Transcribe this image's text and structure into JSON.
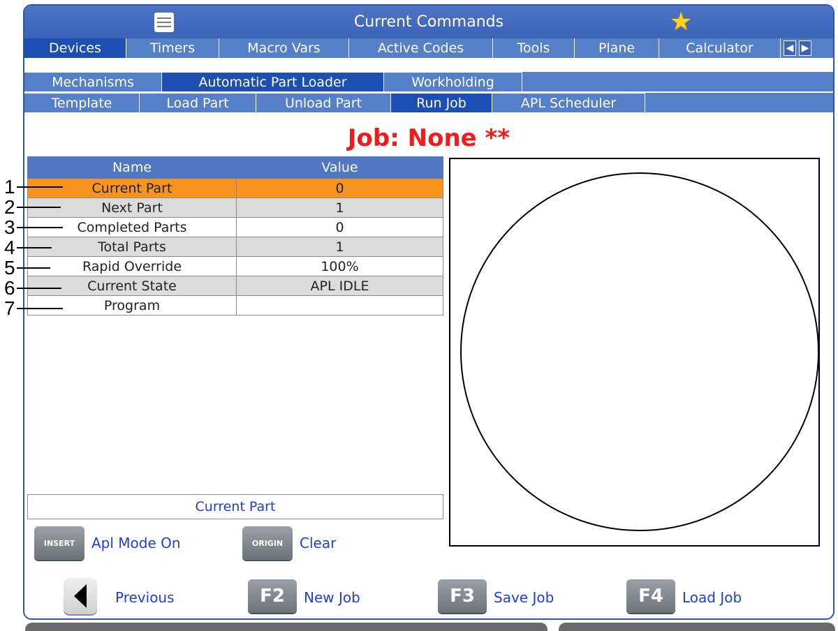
{
  "titlebar": {
    "title": "Current Commands",
    "menu_icon": "hamburger-icon",
    "favorite_icon": "star-icon"
  },
  "tabs_row1": [
    "Devices",
    "Timers",
    "Macro Vars",
    "Active Codes",
    "Tools",
    "Plane",
    "Calculator"
  ],
  "tabs_row1_active": "Devices",
  "tabs_row2": [
    "Mechanisms",
    "Automatic Part Loader",
    "Workholding"
  ],
  "tabs_row2_active": "Automatic Part Loader",
  "tabs_row3": [
    "Template",
    "Load Part",
    "Unload Part",
    "Run Job",
    "APL Scheduler"
  ],
  "tabs_row3_active": "Run Job",
  "job": {
    "title": "Job: None **"
  },
  "table": {
    "headers": {
      "name": "Name",
      "value": "Value"
    },
    "rows": [
      {
        "name": "Current Part",
        "value": "0"
      },
      {
        "name": "Next Part",
        "value": "1"
      },
      {
        "name": "Completed Parts",
        "value": "0"
      },
      {
        "name": "Total Parts",
        "value": "1"
      },
      {
        "name": "Rapid Override",
        "value": "100%"
      },
      {
        "name": "Current State",
        "value": "APL IDLE"
      },
      {
        "name": "Program",
        "value": ""
      }
    ],
    "selected_row": 0
  },
  "callouts": [
    "1",
    "2",
    "3",
    "4",
    "5",
    "6",
    "7"
  ],
  "info": {
    "text": "Current Part"
  },
  "keys": {
    "insert": {
      "key": "INSERT",
      "label": "Apl Mode On"
    },
    "origin": {
      "key": "ORIGIN",
      "label": "Clear"
    }
  },
  "footer": {
    "previous": {
      "label": "Previous"
    },
    "f2": {
      "key": "F2",
      "label": "New Job"
    },
    "f3": {
      "key": "F3",
      "label": "Save Job"
    },
    "f4": {
      "key": "F4",
      "label": "Load Job"
    }
  },
  "colors": {
    "accent_blue": "#2b56b4",
    "tab_blue": "#5580c8",
    "active_tab": "#1d4fb2",
    "selected_row": "#f7941d",
    "job_title": "#ee1c1c",
    "link_text": "#1f3fd0"
  }
}
